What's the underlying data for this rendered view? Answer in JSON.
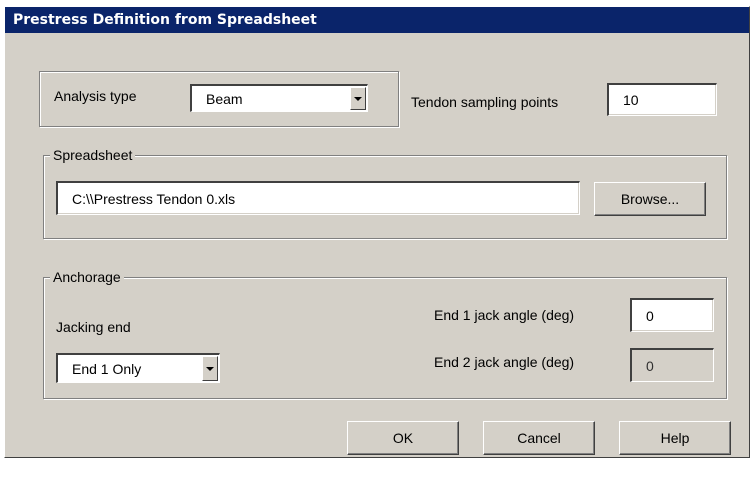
{
  "window": {
    "title": "Prestress Definition from Spreadsheet"
  },
  "analysis": {
    "label": "Analysis type",
    "value": "Beam"
  },
  "tendon": {
    "label": "Tendon sampling points",
    "value": "10"
  },
  "spreadsheet": {
    "group_label": "Spreadsheet",
    "path": "C:\\\\Prestress Tendon 0.xls",
    "browse_label": "Browse..."
  },
  "anchorage": {
    "group_label": "Anchorage",
    "jacking_end_label": "Jacking end",
    "jacking_end_value": "End 1 Only",
    "end1_label": "End 1 jack angle (deg)",
    "end1_value": "0",
    "end2_label": "End 2 jack angle (deg)",
    "end2_value": "0"
  },
  "buttons": {
    "ok": "OK",
    "cancel": "Cancel",
    "help": "Help"
  },
  "colors": {
    "titlebar": "#0a246a",
    "face": "#d4d0c8"
  }
}
